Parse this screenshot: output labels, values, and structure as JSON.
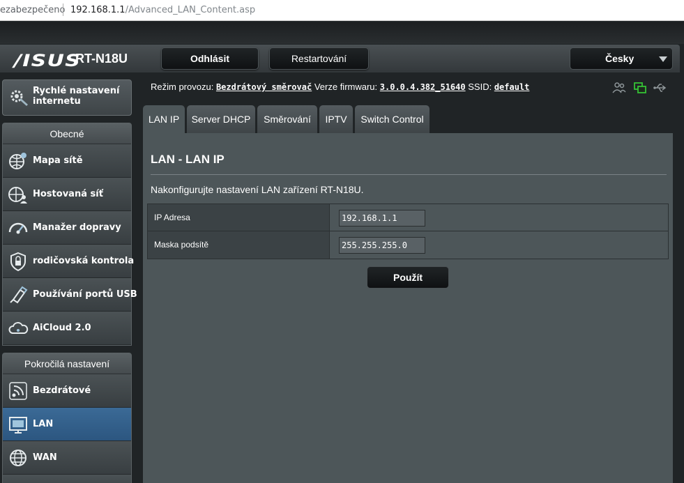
{
  "browser": {
    "insecure_label": "ezabezpečeno",
    "url_host": "192.168.1.1",
    "url_path": "/Advanced_LAN_Content.asp"
  },
  "header": {
    "logo": "/ISUS",
    "model": "RT-N18U",
    "logout_label": "Odhlásit",
    "restart_label": "Restartování",
    "language": "Česky"
  },
  "status": {
    "mode_label": "Režim provozu:",
    "mode_value": "Bezdrátový směrovač",
    "firmware_label": "Verze firmwaru:",
    "firmware_value": "3.0.0.4.382_51640",
    "ssid_label": "SSID:",
    "ssid_value": "default"
  },
  "sidebar": {
    "quick_setup": "Rychlé nastavení internetu",
    "general_header": "Obecné",
    "general_items": [
      {
        "label": "Mapa sítě",
        "icon": "network-map-icon"
      },
      {
        "label": "Hostovaná síť",
        "icon": "guest-network-icon"
      },
      {
        "label": "Manažer dopravy",
        "icon": "traffic-manager-icon"
      },
      {
        "label": "rodičovská kontrola",
        "icon": "parental-control-icon"
      },
      {
        "label": "Používání portů USB",
        "icon": "usb-app-icon"
      },
      {
        "label": "AiCloud 2.0",
        "icon": "aicloud-icon"
      }
    ],
    "advanced_header": "Pokročilá nastavení",
    "advanced_items": [
      {
        "label": "Bezdrátové",
        "icon": "wireless-icon"
      },
      {
        "label": "LAN",
        "icon": "lan-icon",
        "active": true
      },
      {
        "label": "WAN",
        "icon": "wan-icon"
      }
    ]
  },
  "tabs": [
    "LAN IP",
    "Server DHCP",
    "Směrování",
    "IPTV",
    "Switch Control"
  ],
  "content": {
    "title": "LAN - LAN IP",
    "description": "Nakonfigurujte nastavení LAN zařízení RT-N18U.",
    "fields": [
      {
        "label": "IP Adresa",
        "value": "192.168.1.1"
      },
      {
        "label": "Maska podsítě",
        "value": "255.255.255.0"
      }
    ],
    "apply_label": "Použít"
  },
  "colors": {
    "active_nav": "#2f5b86",
    "panel_bg": "#4d5659",
    "status_green": "#35c235"
  }
}
